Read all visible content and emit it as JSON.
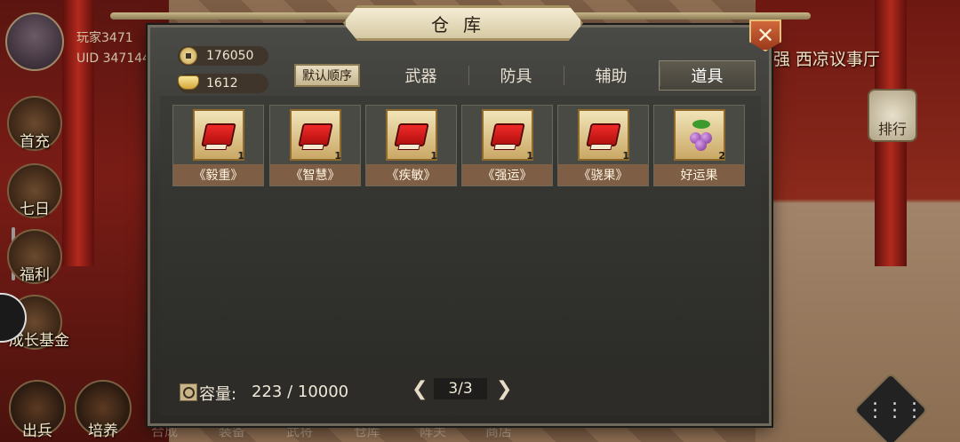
{
  "player": {
    "name": "玩家3471",
    "uid": "UID 347144"
  },
  "left_menu": {
    "first_recharge": "首充",
    "seven_day": "七日",
    "welfare": "福利",
    "growth_fund": "成长基金"
  },
  "bottom_menu": {
    "battle": "出兵",
    "train": "培养",
    "dim_labels": [
      "合成",
      "装备",
      "武将",
      "仓库",
      "阵关",
      "商店"
    ]
  },
  "right_hud": {
    "room_title": "强 西凉议事厅",
    "rank_label": "排行"
  },
  "dialog": {
    "title": "仓库",
    "close_glyph": "✕",
    "currency": {
      "copper": "176050",
      "gold": "1612"
    },
    "sort_button": "默认顺序",
    "tabs": [
      {
        "label": "武器",
        "active": false
      },
      {
        "label": "防具",
        "active": false
      },
      {
        "label": "辅助",
        "active": false
      },
      {
        "label": "道具",
        "active": true
      }
    ],
    "items": [
      {
        "name": "《毅重》",
        "count": "1",
        "icon": "red-book-icon"
      },
      {
        "name": "《智慧》",
        "count": "1",
        "icon": "red-book-icon"
      },
      {
        "name": "《疾敏》",
        "count": "1",
        "icon": "red-book-icon"
      },
      {
        "name": "《强运》",
        "count": "1",
        "icon": "red-book-icon"
      },
      {
        "name": "《骁果》",
        "count": "1",
        "icon": "red-book-icon"
      },
      {
        "name": "好运果",
        "count": "2",
        "icon": "purple-fruit-icon"
      }
    ],
    "capacity_label": "容量:",
    "capacity_value": "223 / 10000",
    "page": "3/3",
    "prev_glyph": "❮",
    "next_glyph": "❯"
  },
  "colors": {
    "item_name_bg": "#7e5f45",
    "active_tab_bg": "#5e5a4e",
    "book_red": "#f02a28"
  }
}
